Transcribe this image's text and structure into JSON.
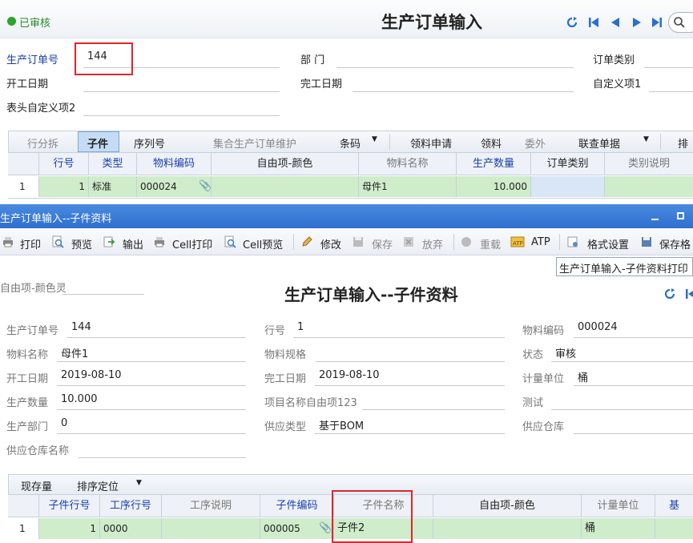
{
  "main": {
    "status": "已审核",
    "title": "生产订单输入",
    "fields": {
      "order_no_label": "生产订单号",
      "order_no_value": "144",
      "dept_label": "部 门",
      "order_type_label": "订单类别",
      "start_date_label": "开工日期",
      "end_date_label": "完工日期",
      "custom1_label": "自定义项1",
      "header_custom2_label": "表头自定义项2"
    },
    "toolbar": {
      "split": "行分拆",
      "child": "子件",
      "serial": "序列号",
      "maintain": "集合生产订单维护",
      "barcode": "条码",
      "material_request": "领料申请",
      "material_pick": "领料",
      "outsource": "委外",
      "link_doc": "联查单据",
      "more": "排"
    },
    "grid": {
      "headers": [
        "行号",
        "类型",
        "物料编码",
        "自由项-颜色",
        "物料名称",
        "生产数量",
        "订单类别",
        "类别说明"
      ],
      "rows": [
        {
          "idx": "1",
          "line": "1",
          "type": "标准",
          "code": "000024",
          "free": "",
          "name": "母件1",
          "qty": "10.000",
          "cat": "",
          "catdesc": ""
        }
      ]
    }
  },
  "dialog": {
    "title": "生产订单输入--子件资料",
    "toolbar": {
      "print": "打印",
      "preview": "预览",
      "export": "输出",
      "cell_print": "Cell打印",
      "cell_preview": "Cell预览",
      "edit": "修改",
      "save": "保存",
      "discard": "放弃",
      "reload": "重载",
      "atp": "ATP",
      "format": "格式设置",
      "save_format": "保存格"
    },
    "print_template": "生产订单输入-子件资料打印",
    "free_color_label": "自由项-颜色灵",
    "form_title": "生产订单输入--子件资料",
    "fields": {
      "order_no_label": "生产订单号",
      "order_no": "144",
      "line_label": "行号",
      "line": "1",
      "mat_code_label": "物料编码",
      "mat_code": "000024",
      "mat_name_label": "物料名称",
      "mat_name": "母件1",
      "mat_spec_label": "物料规格",
      "state_label": "状态",
      "state": "审核",
      "start_label": "开工日期",
      "start": "2019-08-10",
      "end_label": "完工日期",
      "end": "2019-08-10",
      "unit_label": "计量单位",
      "unit": "桶",
      "qty_label": "生产数量",
      "qty": "10.000",
      "proj_label": "项目名称自由项123",
      "test_label": "测试",
      "dept_label": "生产部门",
      "dept": "0",
      "supply_type_label": "供应类型",
      "supply_type": "基于BOM",
      "supply_wh_label": "供应仓库",
      "supply_wh_name_label": "供应仓库名称"
    },
    "subtoolbar": {
      "stock": "现存量",
      "sort": "排序定位"
    },
    "grid": {
      "headers": [
        "子件行号",
        "工序行号",
        "工序说明",
        "子件编码",
        "子件名称",
        "自由项-颜色",
        "计量单位",
        "基"
      ],
      "rows": [
        {
          "idx": "1",
          "child_line": "1",
          "proc_line": "0000",
          "proc_desc": "",
          "code": "000005",
          "name": "子件2",
          "free": "",
          "unit": "桶"
        }
      ]
    }
  },
  "colors": {
    "accent_blue": "#1a3fb0",
    "row_green": "#cfeccb",
    "dialog_title_bg": "#2f6fcf",
    "highlight_red": "#e0262b",
    "status_green": "#2aa52a"
  }
}
